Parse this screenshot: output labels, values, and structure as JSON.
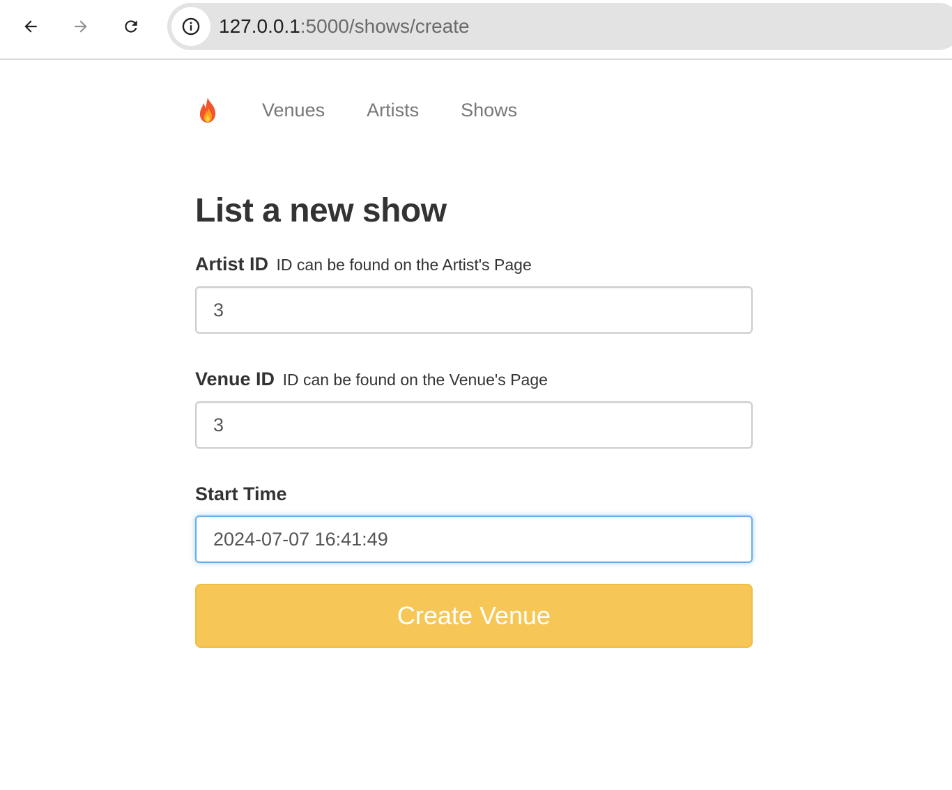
{
  "browser": {
    "url_host": "127.0.0.1",
    "url_path": ":5000/shows/create"
  },
  "navbar": {
    "brand_icon": "fire-emoji-icon",
    "links": [
      {
        "label": "Venues"
      },
      {
        "label": "Artists"
      },
      {
        "label": "Shows"
      }
    ]
  },
  "form": {
    "title": "List a new show",
    "artist_id": {
      "label": "Artist ID",
      "help": "ID can be found on the Artist's Page",
      "value": "3"
    },
    "venue_id": {
      "label": "Venue ID",
      "help": "ID can be found on the Venue's Page",
      "value": "3"
    },
    "start_time": {
      "label": "Start Time",
      "value": "2024-07-07 16:41:49"
    },
    "submit_label": "Create Venue"
  },
  "colors": {
    "submit_bg": "#f6c756",
    "focus_border": "#66afe9",
    "nav_link": "#777777"
  }
}
